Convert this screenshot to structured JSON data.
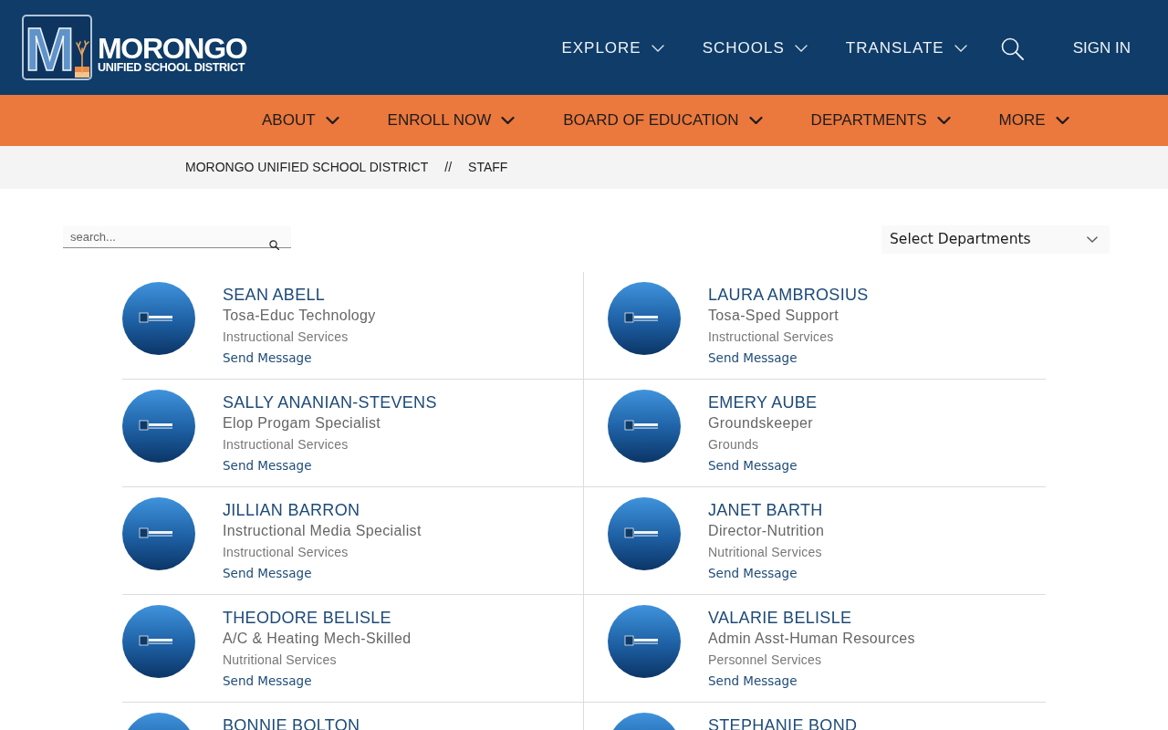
{
  "header": {
    "logo": {
      "mark": "M",
      "name": "MORONGO",
      "tagline": "UNIFIED SCHOOL DISTRICT"
    },
    "nav": [
      {
        "kind": "dropdown",
        "label": "EXPLORE"
      },
      {
        "kind": "dropdown",
        "label": "SCHOOLS"
      },
      {
        "kind": "dropdown",
        "label": "TRANSLATE"
      },
      {
        "kind": "search"
      },
      {
        "kind": "link",
        "label": "SIGN IN"
      }
    ]
  },
  "main_nav": [
    {
      "label": "ABOUT"
    },
    {
      "label": "ENROLL NOW"
    },
    {
      "label": "BOARD OF EDUCATION"
    },
    {
      "label": "DEPARTMENTS"
    },
    {
      "label": "MORE"
    }
  ],
  "breadcrumb": {
    "items": [
      "MORONGO UNIFIED SCHOOL DISTRICT",
      "STAFF"
    ],
    "separator": "//"
  },
  "search": {
    "placeholder": "search..."
  },
  "department_filter": {
    "value": "Select Departments"
  },
  "staff": [
    {
      "name": "SEAN ABELL",
      "title": "Tosa-Educ Technology",
      "department": "Instructional Services",
      "action": "Send Message"
    },
    {
      "name": "LAURA AMBROSIUS",
      "title": "Tosa-Sped Support",
      "department": "Instructional Services",
      "action": "Send Message"
    },
    {
      "name": "SALLY ANANIAN-STEVENS",
      "title": "Elop Progam Specialist",
      "department": "Instructional Services",
      "action": "Send Message"
    },
    {
      "name": "EMERY AUBE",
      "title": "Groundskeeper",
      "department": "Grounds",
      "action": "Send Message"
    },
    {
      "name": "JILLIAN BARRON",
      "title": "Instructional Media Specialist",
      "department": "Instructional Services",
      "action": "Send Message"
    },
    {
      "name": "JANET BARTH",
      "title": "Director-Nutrition",
      "department": "Nutritional Services",
      "action": "Send Message"
    },
    {
      "name": "THEODORE BELISLE",
      "title": "A/C & Heating Mech-Skilled",
      "department": "Nutritional Services",
      "action": "Send Message"
    },
    {
      "name": "VALARIE BELISLE",
      "title": "Admin Asst-Human Resources",
      "department": "Personnel Services",
      "action": "Send Message"
    },
    {
      "name": "BONNIE BOLTON"
    },
    {
      "name": "STEPHANIE BOND"
    }
  ]
}
